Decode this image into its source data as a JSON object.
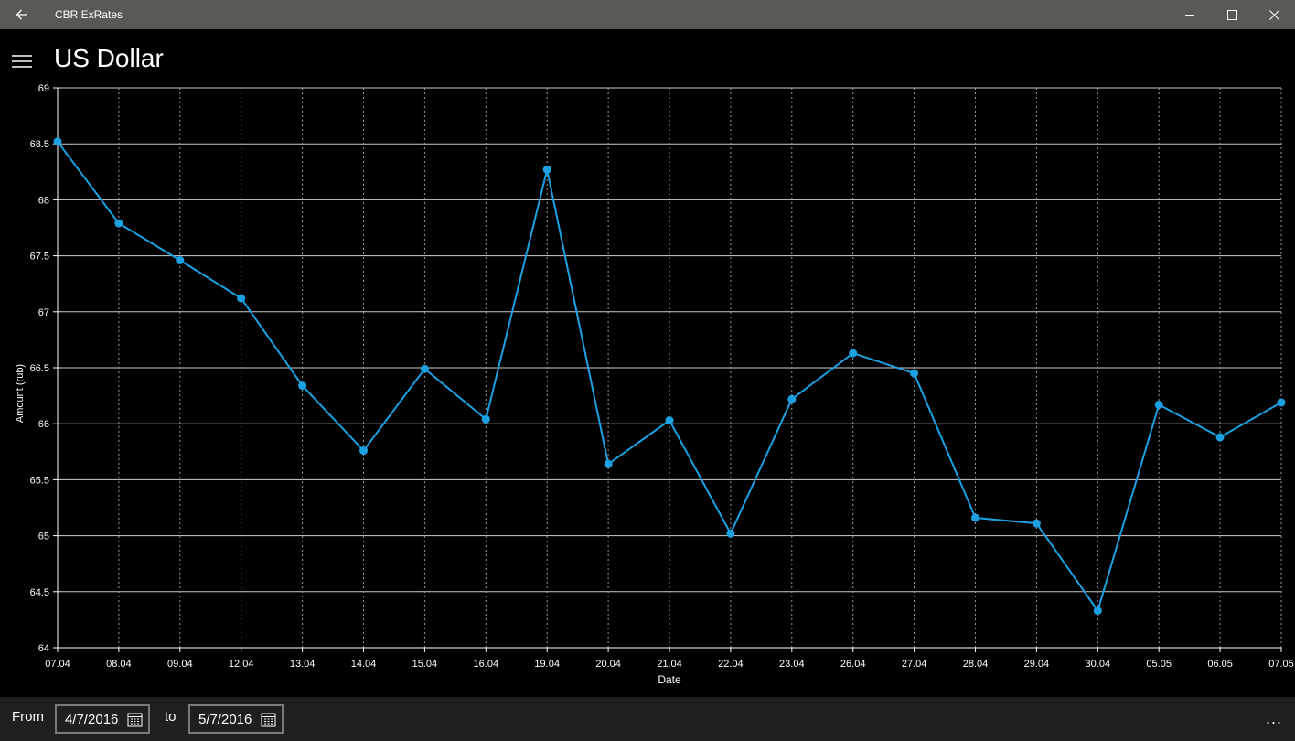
{
  "window": {
    "title": "CBR ExRates"
  },
  "page": {
    "title": "US Dollar"
  },
  "chart_data": {
    "type": "line",
    "xlabel": "Date",
    "ylabel": "Amount (rub)",
    "ylim": [
      64,
      69
    ],
    "yticks": [
      "69",
      "68.5",
      "68",
      "67.5",
      "67",
      "66.5",
      "66",
      "65.5",
      "65",
      "64.5",
      "64"
    ],
    "grid": true,
    "series_color": "#1ba1e2",
    "categories": [
      "07.04",
      "08.04",
      "09.04",
      "12.04",
      "13.04",
      "14.04",
      "15.04",
      "16.04",
      "19.04",
      "20.04",
      "21.04",
      "22.04",
      "23.04",
      "26.04",
      "27.04",
      "28.04",
      "29.04",
      "30.04",
      "05.05",
      "06.05",
      "07.05"
    ],
    "values": [
      68.52,
      67.79,
      67.46,
      67.12,
      66.34,
      65.76,
      66.49,
      66.04,
      68.27,
      65.64,
      66.03,
      65.02,
      66.22,
      66.63,
      66.45,
      65.16,
      65.11,
      64.33,
      66.17,
      65.88,
      66.19
    ]
  },
  "bottom": {
    "from_label": "From",
    "from_value": "4/7/2016",
    "to_label": "to",
    "to_value": "5/7/2016",
    "more_label": "..."
  }
}
